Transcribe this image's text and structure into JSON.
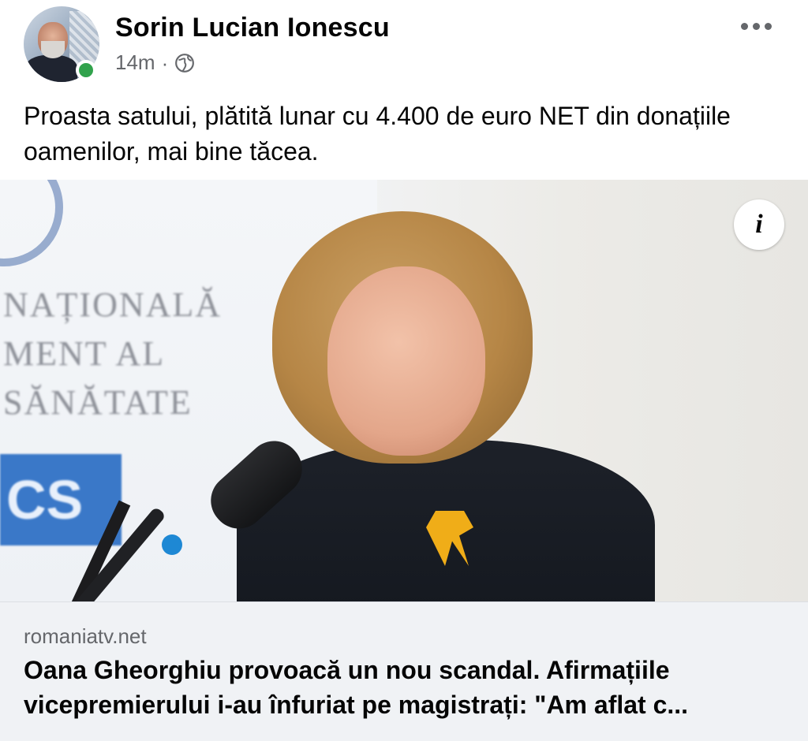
{
  "post": {
    "author": "Sorin Lucian Ionescu",
    "timestamp": "14m",
    "separator": "·",
    "privacy_icon": "globe-icon",
    "text": "Proasta satului, plătită lunar cu 4.400 de euro NET din donațiile oamenilor, mai bine tăcea."
  },
  "link_card": {
    "image_banner_text": "NAȚIONALĂ\nMENT AL\nSĂNĂTATE",
    "image_logo_text": "CS",
    "info_label": "i",
    "domain": "romaniatv.net",
    "title": "Oana Gheorghiu provoacă un nou scandal. Afirmațiile vicepremierului i-au înfuriat pe magistrați: \"Am aflat c..."
  },
  "colors": {
    "online_indicator": "#31a24c",
    "meta_text": "#65676b",
    "footer_background": "#f0f2f5"
  }
}
